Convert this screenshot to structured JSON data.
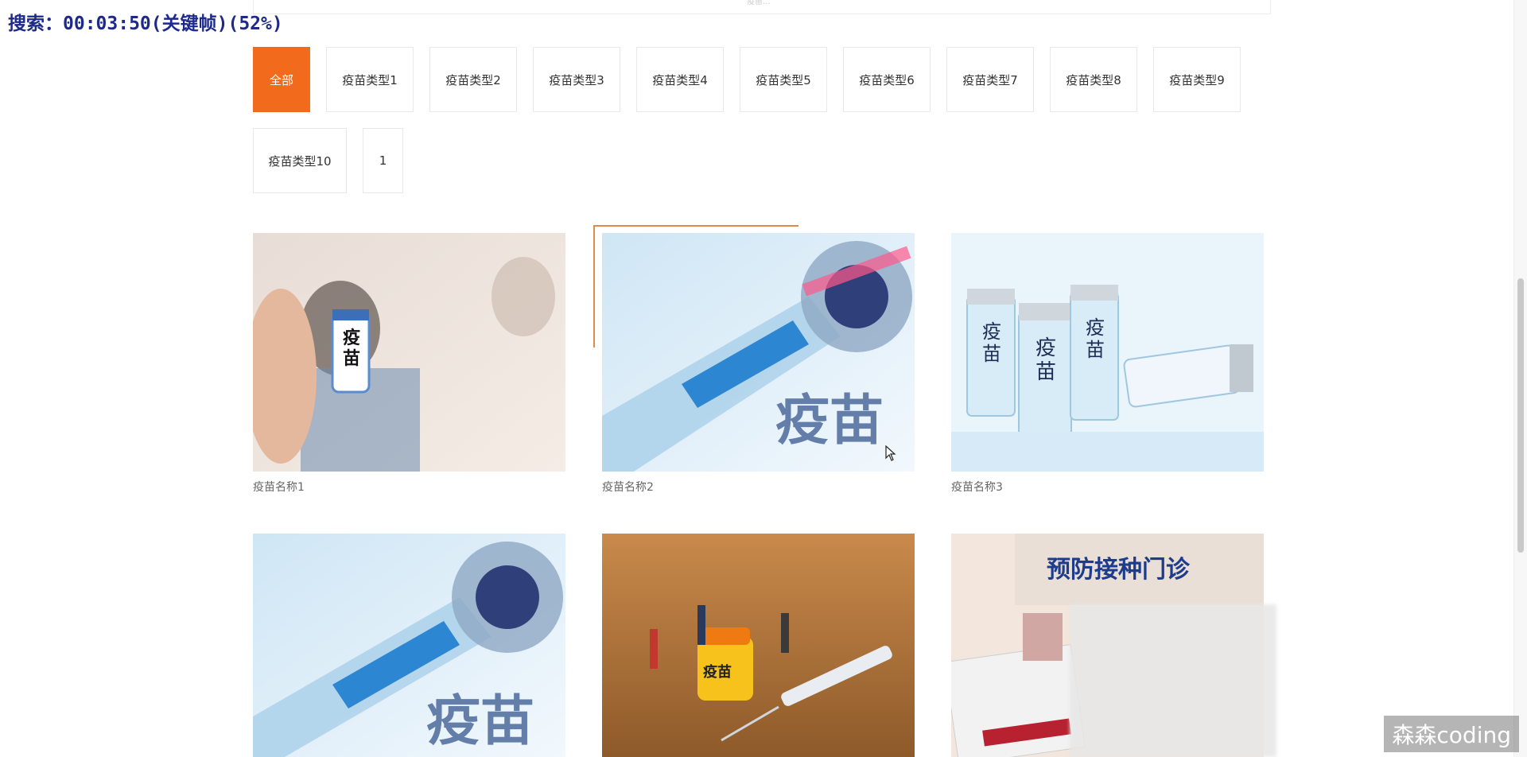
{
  "overlay": {
    "search_label": "搜索：00:03:50(关键帧)(52%)"
  },
  "top_bar": {
    "text": "疫苗..."
  },
  "filters": {
    "row1": [
      "全部",
      "疫苗类型1",
      "疫苗类型2",
      "疫苗类型3",
      "疫苗类型4",
      "疫苗类型5",
      "疫苗类型6",
      "疫苗类型7",
      "疫苗类型8",
      "疫苗类型9"
    ],
    "row2": [
      "疫苗类型10",
      "1"
    ],
    "active": "全部"
  },
  "cards": [
    {
      "name": "疫苗名称1",
      "image_text": "疫苗"
    },
    {
      "name": "疫苗名称2",
      "image_text": "疫苗"
    },
    {
      "name": "疫苗名称3",
      "image_text": "疫苗"
    },
    {
      "name": "",
      "image_text": "疫苗"
    },
    {
      "name": "",
      "image_text": "疫苗"
    },
    {
      "name": "",
      "image_text": "预防接种门诊"
    }
  ],
  "watermark": "森森coding",
  "colors": {
    "accent": "#f26a1b",
    "hover_frame": "#e08a4a"
  }
}
